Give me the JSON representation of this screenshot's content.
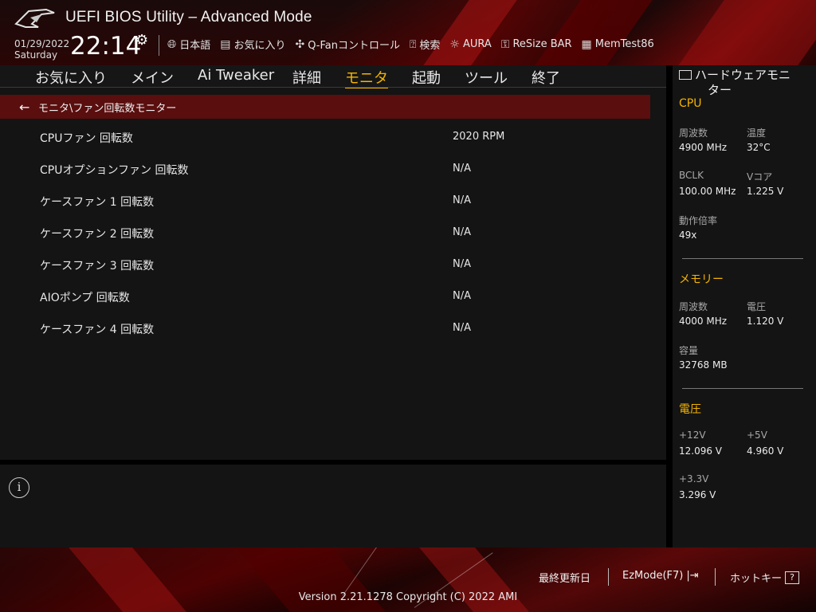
{
  "header": {
    "title": "UEFI BIOS Utility – Advanced Mode",
    "date": "01/29/2022",
    "day": "Saturday",
    "time": "22:14",
    "tools": [
      {
        "label": "日本語",
        "icon": "globe-icon"
      },
      {
        "label": "お気に入り",
        "icon": "favorites-icon"
      },
      {
        "label": "Q-Fanコントロール",
        "icon": "fan-icon"
      },
      {
        "label": "検索",
        "icon": "help-search-icon"
      },
      {
        "label": "AURA",
        "icon": "aura-icon"
      },
      {
        "label": "ReSize BAR",
        "icon": "resize-bar-icon"
      },
      {
        "label": "MemTest86",
        "icon": "memtest-icon"
      }
    ]
  },
  "tabs": [
    {
      "label": "お気に入り",
      "active": false
    },
    {
      "label": "メイン",
      "active": false
    },
    {
      "label": "Ai Tweaker",
      "active": false
    },
    {
      "label": "詳細",
      "active": false
    },
    {
      "label": "モニタ",
      "active": true
    },
    {
      "label": "起動",
      "active": false
    },
    {
      "label": "ツール",
      "active": false
    },
    {
      "label": "終了",
      "active": false
    }
  ],
  "breadcrumb": "モニタ\\ファン回転数モニター",
  "rows": [
    {
      "label": "CPUファン 回転数",
      "value": "2020 RPM"
    },
    {
      "label": "CPUオプションファン 回転数",
      "value": "N/A"
    },
    {
      "label": "ケースファン 1 回転数",
      "value": "N/A"
    },
    {
      "label": "ケースファン 2 回転数",
      "value": "N/A"
    },
    {
      "label": "ケースファン 3 回転数",
      "value": "N/A"
    },
    {
      "label": "AIOポンプ 回転数",
      "value": "N/A"
    },
    {
      "label": "ケースファン 4 回転数",
      "value": "N/A"
    }
  ],
  "hw": {
    "title_line1": "ハードウェアモニ",
    "title_line2": "ター",
    "cpu": {
      "title": "CPU",
      "freq_label": "周波数",
      "freq": "4900 MHz",
      "temp_label": "温度",
      "temp": "32°C",
      "bclk_label": "BCLK",
      "bclk": "100.00 MHz",
      "vcore_label": "Vコア",
      "vcore": "1.225 V",
      "ratio_label": "動作倍率",
      "ratio": "49x"
    },
    "memory": {
      "title": "メモリー",
      "freq_label": "周波数",
      "freq": "4000 MHz",
      "volt_label": "電圧",
      "volt": "1.120 V",
      "cap_label": "容量",
      "cap": "32768 MB"
    },
    "voltage": {
      "title": "電圧",
      "v12_label": "+12V",
      "v12": "12.096 V",
      "v5_label": "+5V",
      "v5": "4.960 V",
      "v33_label": "+3.3V",
      "v33": "3.296 V"
    }
  },
  "footer": {
    "last_modified": "最終更新日",
    "ezmode": "EzMode(F7)",
    "hotkeys": "ホットキー",
    "version": "Version 2.21.1278 Copyright (C) 2022 AMI"
  },
  "colors": {
    "accent": "#f5b400",
    "breadcrumb_bg": "#5a0e0e"
  }
}
